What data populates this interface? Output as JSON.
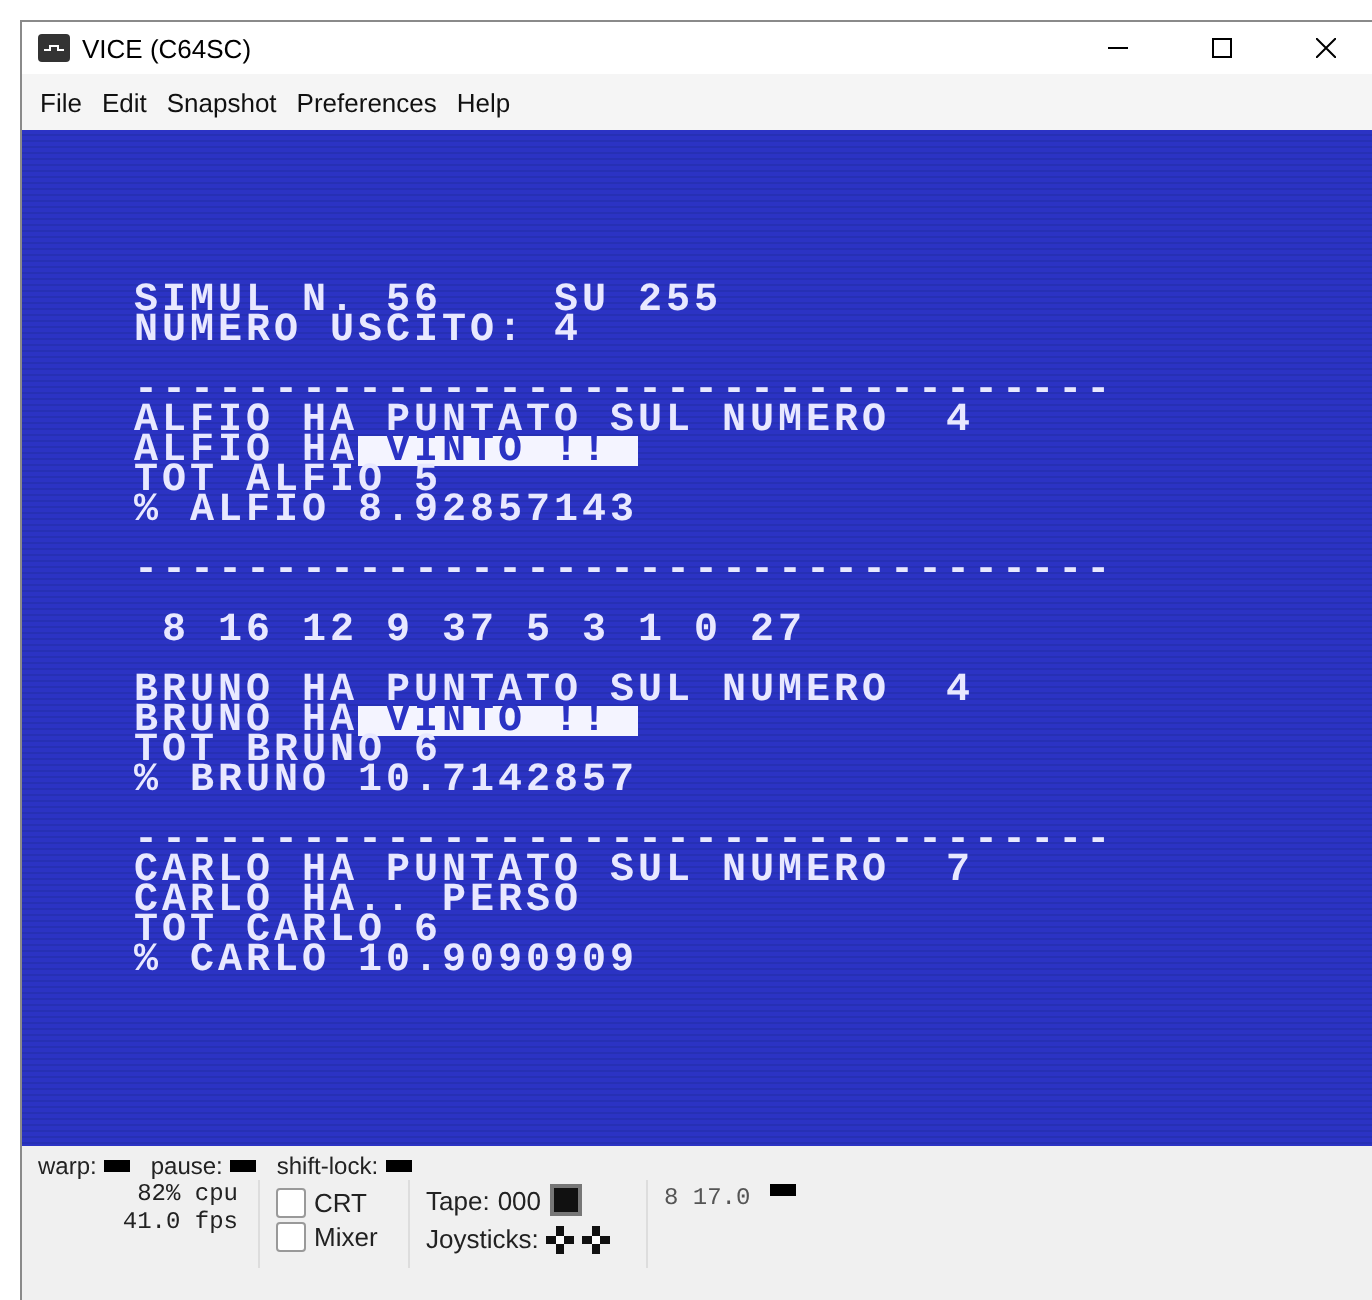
{
  "window": {
    "title": "VICE (C64SC)"
  },
  "menu": [
    "File",
    "Edit",
    "Snapshot",
    "Preferences",
    "Help"
  ],
  "screen_lines": [
    {
      "kind": "text",
      "segments": [
        {
          "text": "SIMUL N. 56    SU 255",
          "reverse": false
        }
      ]
    },
    {
      "kind": "text",
      "segments": [
        {
          "text": "NUMERO USCITO: 4",
          "reverse": false
        }
      ]
    },
    {
      "kind": "blank"
    },
    {
      "kind": "text",
      "segments": [
        {
          "text": "-----------------------------------",
          "reverse": false
        }
      ]
    },
    {
      "kind": "text",
      "segments": [
        {
          "text": "ALFIO HA PUNTATO SUL NUMERO  4",
          "reverse": false
        }
      ]
    },
    {
      "kind": "text",
      "segments": [
        {
          "text": "ALFIO HA",
          "reverse": false
        },
        {
          "text": " VINTO !! ",
          "reverse": true
        }
      ]
    },
    {
      "kind": "text",
      "segments": [
        {
          "text": "TOT ALFIO 5",
          "reverse": false
        }
      ]
    },
    {
      "kind": "text",
      "segments": [
        {
          "text": "% ALFIO 8.92857143",
          "reverse": false
        }
      ]
    },
    {
      "kind": "blank"
    },
    {
      "kind": "text",
      "segments": [
        {
          "text": "-----------------------------------",
          "reverse": false
        }
      ]
    },
    {
      "kind": "blank"
    },
    {
      "kind": "text",
      "segments": [
        {
          "text": " 8 16 12 9 37 5 3 1 0 27",
          "reverse": false
        }
      ]
    },
    {
      "kind": "blank"
    },
    {
      "kind": "text",
      "segments": [
        {
          "text": "BRUNO HA PUNTATO SUL NUMERO  4",
          "reverse": false
        }
      ]
    },
    {
      "kind": "text",
      "segments": [
        {
          "text": "BRUNO HA",
          "reverse": false
        },
        {
          "text": " VINTO !! ",
          "reverse": true
        }
      ]
    },
    {
      "kind": "text",
      "segments": [
        {
          "text": "TOT BRUNO 6",
          "reverse": false
        }
      ]
    },
    {
      "kind": "text",
      "segments": [
        {
          "text": "% BRUNO 10.7142857",
          "reverse": false
        }
      ]
    },
    {
      "kind": "blank"
    },
    {
      "kind": "text",
      "segments": [
        {
          "text": "-----------------------------------",
          "reverse": false
        }
      ]
    },
    {
      "kind": "text",
      "segments": [
        {
          "text": "CARLO HA PUNTATO SUL NUMERO  7",
          "reverse": false
        }
      ]
    },
    {
      "kind": "text",
      "segments": [
        {
          "text": "CARLO HA.. PERSO",
          "reverse": false
        }
      ]
    },
    {
      "kind": "text",
      "segments": [
        {
          "text": "TOT CARLO 6",
          "reverse": false
        }
      ]
    },
    {
      "kind": "text",
      "segments": [
        {
          "text": "% CARLO 10.9090909",
          "reverse": false
        }
      ]
    }
  ],
  "status_bar": {
    "indicators": [
      "warp:",
      "pause:",
      "shift-lock:"
    ],
    "speed": {
      "cpu": "82% cpu",
      "fps": "41.0 fps"
    },
    "checkboxes": [
      {
        "label": "CRT",
        "checked": false
      },
      {
        "label": "Mixer",
        "checked": false
      }
    ],
    "tape": {
      "label": "Tape:",
      "counter": "000"
    },
    "joysticks": {
      "label": "Joysticks:"
    },
    "drive": {
      "text": "8 17.0"
    }
  }
}
